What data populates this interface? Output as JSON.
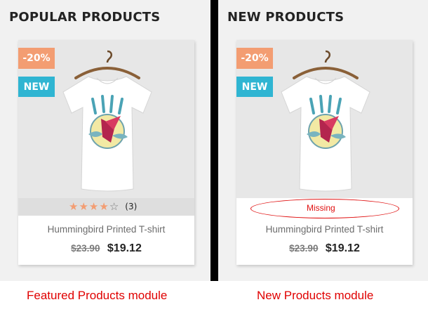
{
  "colors": {
    "panel_bg": "#f1f1f1",
    "divider": "#000000",
    "discount_badge": "#f39d72",
    "new_badge": "#2fb5d2",
    "star_filled": "#f39d72",
    "annotation_red": "#e00000"
  },
  "popular": {
    "title": "POPULAR PRODUCTS",
    "product": {
      "discount_badge": "-20%",
      "new_badge": "NEW",
      "rating": 4,
      "rating_max": 5,
      "review_count": "(3)",
      "name": "Hummingbird Printed T-shirt",
      "old_price": "$23.90",
      "price": "$19.12",
      "image_icon": "tshirt-icon"
    },
    "caption": "Featured Products module"
  },
  "new_products": {
    "title": "NEW PRODUCTS",
    "product": {
      "discount_badge": "-20%",
      "new_badge": "NEW",
      "missing_note": "Missing",
      "name": "Hummingbird Printed T-shirt",
      "old_price": "$23.90",
      "price": "$19.12",
      "image_icon": "tshirt-icon"
    },
    "caption": "New Products module"
  }
}
